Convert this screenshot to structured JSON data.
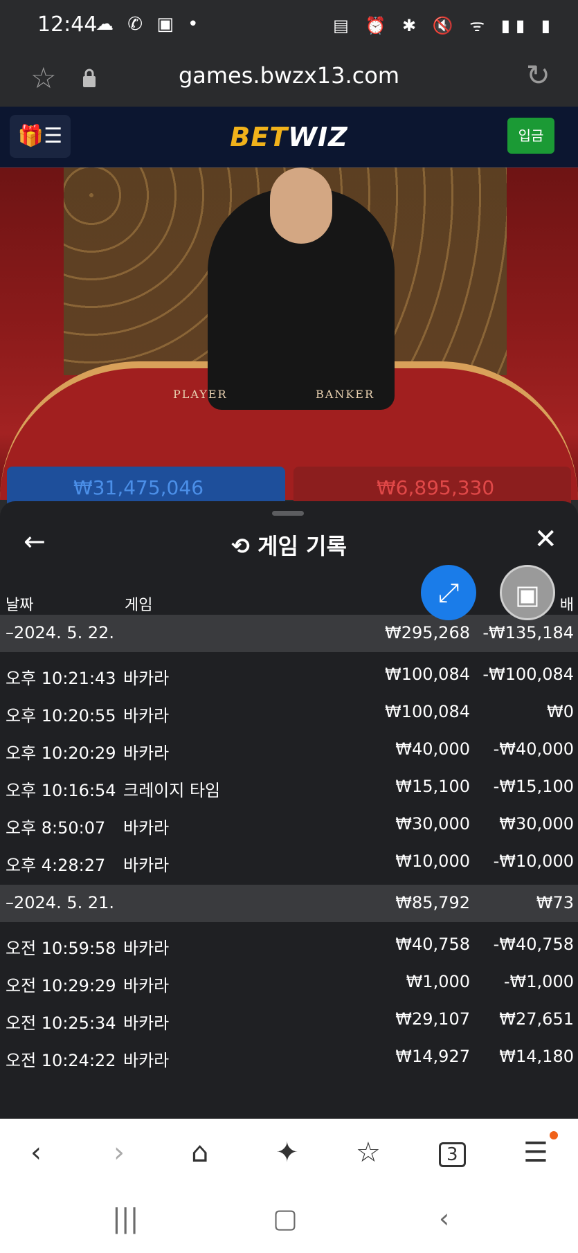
{
  "status_bar": {
    "time": "12:44",
    "left_icons": "☁ ✆ ▣ •",
    "right_icons": "▤ ⏰ ✱ 🔇 ᯤ ▮▮ ▮"
  },
  "browser": {
    "url": "games.bwzx13.com"
  },
  "site_header": {
    "menu_label": "🎁☰",
    "logo_part1": "BET",
    "logo_part2": "WIZ",
    "deposit_label": "입금"
  },
  "video": {
    "player_label": "PLAYER",
    "banker_label": "BANKER"
  },
  "bets": {
    "player_total": "₩31,475,046",
    "banker_total": "₩6,895,330"
  },
  "history": {
    "title": "게임 기록",
    "columns": {
      "date": "날짜",
      "game": "게임",
      "profit": "배"
    },
    "groups": [
      {
        "date": "–2024. 5. 22.",
        "bet": "₩295,268",
        "profit": "-₩135,184",
        "rows": [
          {
            "time": "오후 10:21:43",
            "game": "바카라",
            "bet": "₩100,084",
            "profit": "-₩100,084"
          },
          {
            "time": "오후 10:20:55",
            "game": "바카라",
            "bet": "₩100,084",
            "profit": "₩0"
          },
          {
            "time": "오후 10:20:29",
            "game": "바카라",
            "bet": "₩40,000",
            "profit": "-₩40,000"
          },
          {
            "time": "오후 10:16:54",
            "game": "크레이지 타임",
            "bet": "₩15,100",
            "profit": "-₩15,100"
          },
          {
            "time": "오후 8:50:07",
            "game": "바카라",
            "bet": "₩30,000",
            "profit": "₩30,000"
          },
          {
            "time": "오후 4:28:27",
            "game": "바카라",
            "bet": "₩10,000",
            "profit": "-₩10,000"
          }
        ]
      },
      {
        "date": "–2024. 5. 21.",
        "bet": "₩85,792",
        "profit": "₩73",
        "rows": [
          {
            "time": "오전 10:59:58",
            "game": "바카라",
            "bet": "₩40,758",
            "profit": "-₩40,758"
          },
          {
            "time": "오전 10:29:29",
            "game": "바카라",
            "bet": "₩1,000",
            "profit": "-₩1,000"
          },
          {
            "time": "오전 10:25:34",
            "game": "바카라",
            "bet": "₩29,107",
            "profit": "₩27,651"
          },
          {
            "time": "오전 10:24:22",
            "game": "바카라",
            "bet": "₩14,927",
            "profit": "₩14,180"
          }
        ]
      }
    ]
  },
  "browser_nav": {
    "tab_count": "3"
  }
}
